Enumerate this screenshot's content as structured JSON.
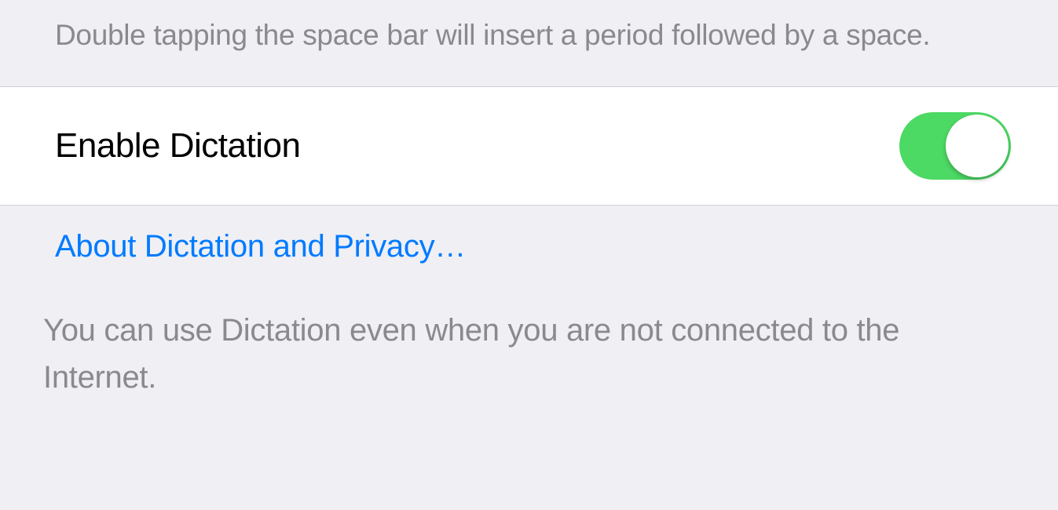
{
  "shortcutFooter": "Double tapping the space bar will insert a period followed by a space.",
  "dictation": {
    "label": "Enable Dictation",
    "enabled": true,
    "privacyLink": "About Dictation and Privacy…",
    "description": "You can use Dictation even when you are not connected to the Internet."
  },
  "colors": {
    "background": "#efeff4",
    "rowBackground": "#ffffff",
    "separator": "#d1d1d5",
    "secondaryText": "#8a8a8e",
    "primaryText": "#000000",
    "link": "#007aff",
    "toggleOn": "#4cd964"
  }
}
